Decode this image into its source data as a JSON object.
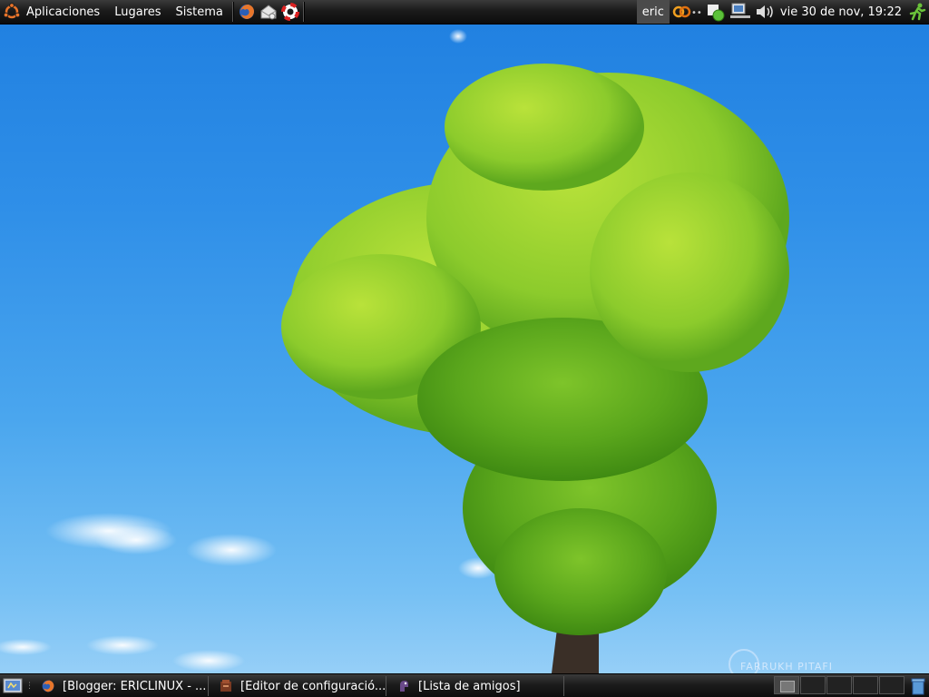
{
  "top_panel": {
    "menus": [
      "Aplicaciones",
      "Lugares",
      "Sistema"
    ],
    "launchers": [
      "firefox-icon",
      "mail-icon",
      "help-icon"
    ],
    "user": "eric",
    "tray_icons": [
      "chat-icon",
      "network-status-icon",
      "network-icon",
      "volume-icon"
    ],
    "clock": "vie 30 de nov, 19:22",
    "logout_icon": "running-man-icon"
  },
  "bottom_panel": {
    "tasks": [
      {
        "label": "[Blogger: ERICLINUX - ...",
        "icon": "firefox-icon"
      },
      {
        "label": "[Editor de configuració...",
        "icon": "config-editor-icon"
      },
      {
        "label": "[Lista de amigos]",
        "icon": "pidgin-icon"
      }
    ],
    "workspaces": 5,
    "active_workspace": 1
  },
  "wallpaper": {
    "watermark": "FARRUKH PITAFI"
  }
}
